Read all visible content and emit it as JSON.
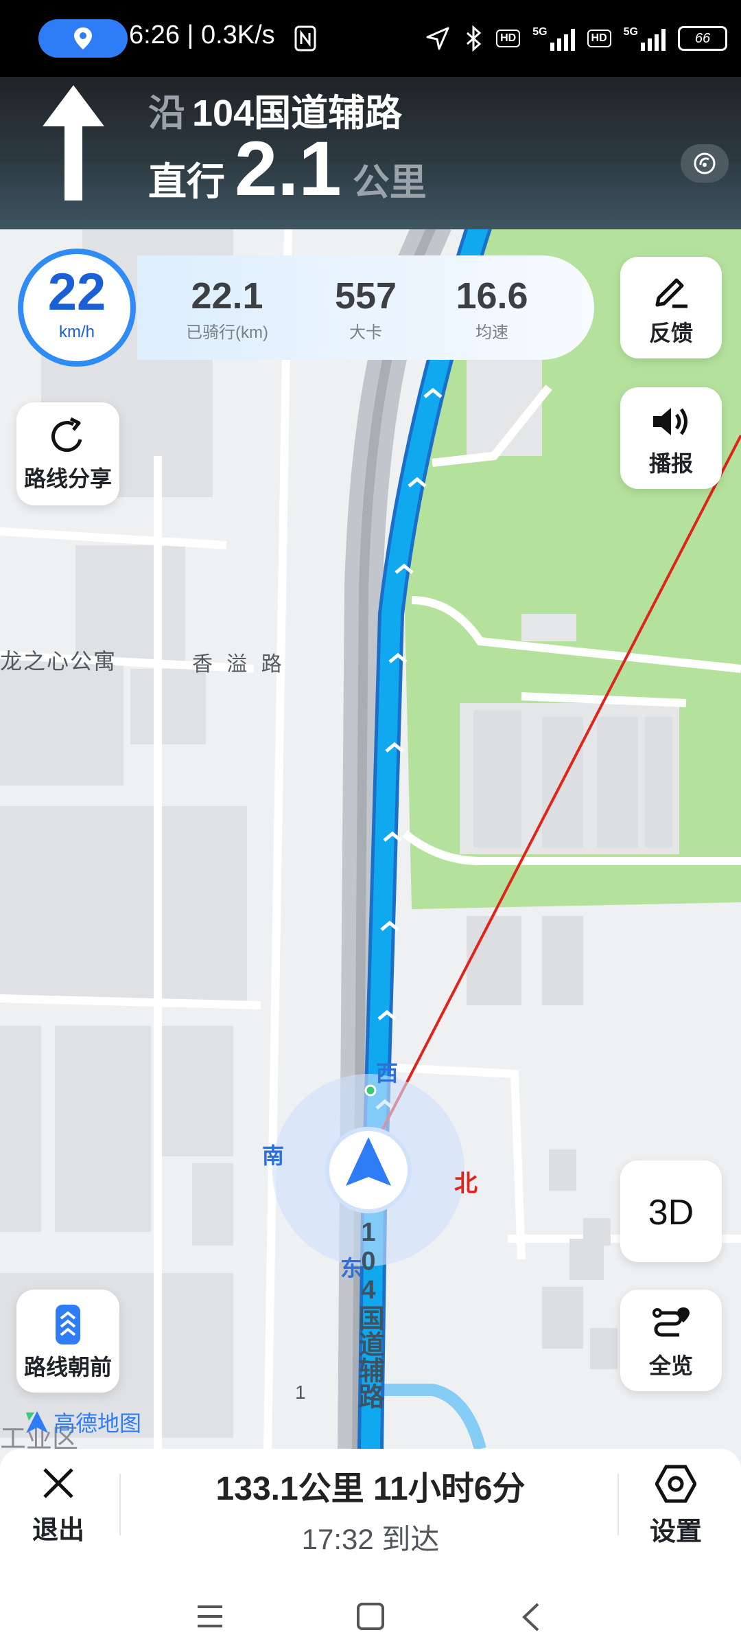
{
  "status_bar": {
    "time_speed": "6:26 | 0.3K/s",
    "hd1": "HD",
    "net1": "5G",
    "hd2": "HD",
    "net2": "5G",
    "battery": "66",
    "icons": [
      "location-pin-icon",
      "nfc-icon",
      "gps-arrow-icon",
      "bluetooth-icon",
      "signal-icon",
      "battery-icon"
    ]
  },
  "nav_header": {
    "along_prefix": "沿",
    "road_name": "104国道辅路",
    "action": "直行",
    "distance": "2.1",
    "distance_unit": "公里",
    "maneuver_icon": "straight-arrow-icon"
  },
  "map": {
    "poi_apartment": "龙之心公寓",
    "street_label": "香 溢 路",
    "compass": {
      "west": "西",
      "south": "南",
      "north": "北",
      "east": "东"
    },
    "road_vertical": "104国道辅路",
    "km_marker": "1",
    "bottom_fragment": "工业区",
    "colors": {
      "route": "#10a9f0",
      "green_area": "#b4e29c",
      "line": "#e0241a",
      "location": "#2f7df6"
    }
  },
  "ride_stats": {
    "speed": "22",
    "speed_unit": "km/h",
    "items": [
      {
        "value": "22.1",
        "label": "已骑行(km)"
      },
      {
        "value": "557",
        "label": "大卡"
      },
      {
        "value": "16.6",
        "label": "均速"
      }
    ]
  },
  "buttons": {
    "feedback": "反馈",
    "broadcast": "播报",
    "route_share": "路线分享",
    "route_forward": "路线朝前",
    "three_d": "3D",
    "overview": "全览"
  },
  "brand": "高德地图",
  "bottom_bar": {
    "exit": "退出",
    "remaining": "133.1公里  11小时6分",
    "arrival": "17:32 到达",
    "settings": "设置"
  }
}
